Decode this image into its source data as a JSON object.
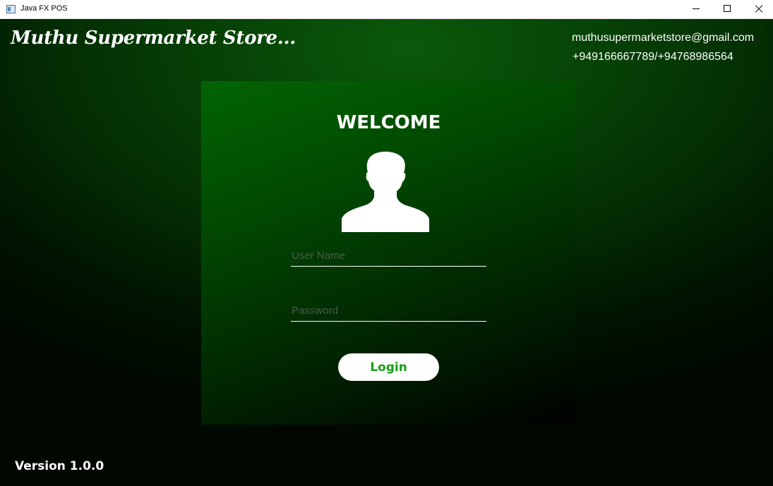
{
  "window": {
    "title": "Java FX POS",
    "icon": "app-window-icon",
    "controls": [
      "minimize-icon",
      "maximize-icon",
      "close-icon"
    ]
  },
  "header": {
    "store_name": "Muthu Supermarket Store...",
    "email": "muthusupermarketstore@gmail.com",
    "phone": "+949166667789/+94768986564"
  },
  "login": {
    "welcome": "WELCOME",
    "avatar_icon": "user-silhouette-icon",
    "username": {
      "placeholder": "User Name",
      "value": ""
    },
    "password": {
      "placeholder": "Password",
      "value": ""
    },
    "button_label": "Login"
  },
  "footer": {
    "version": "Version 1.0.0"
  },
  "colors": {
    "background_dark": "#000000",
    "background_green": "#064206",
    "card_top": "#026402",
    "button_bg": "#ffffff",
    "button_text": "#11a011",
    "text": "#ffffff"
  }
}
